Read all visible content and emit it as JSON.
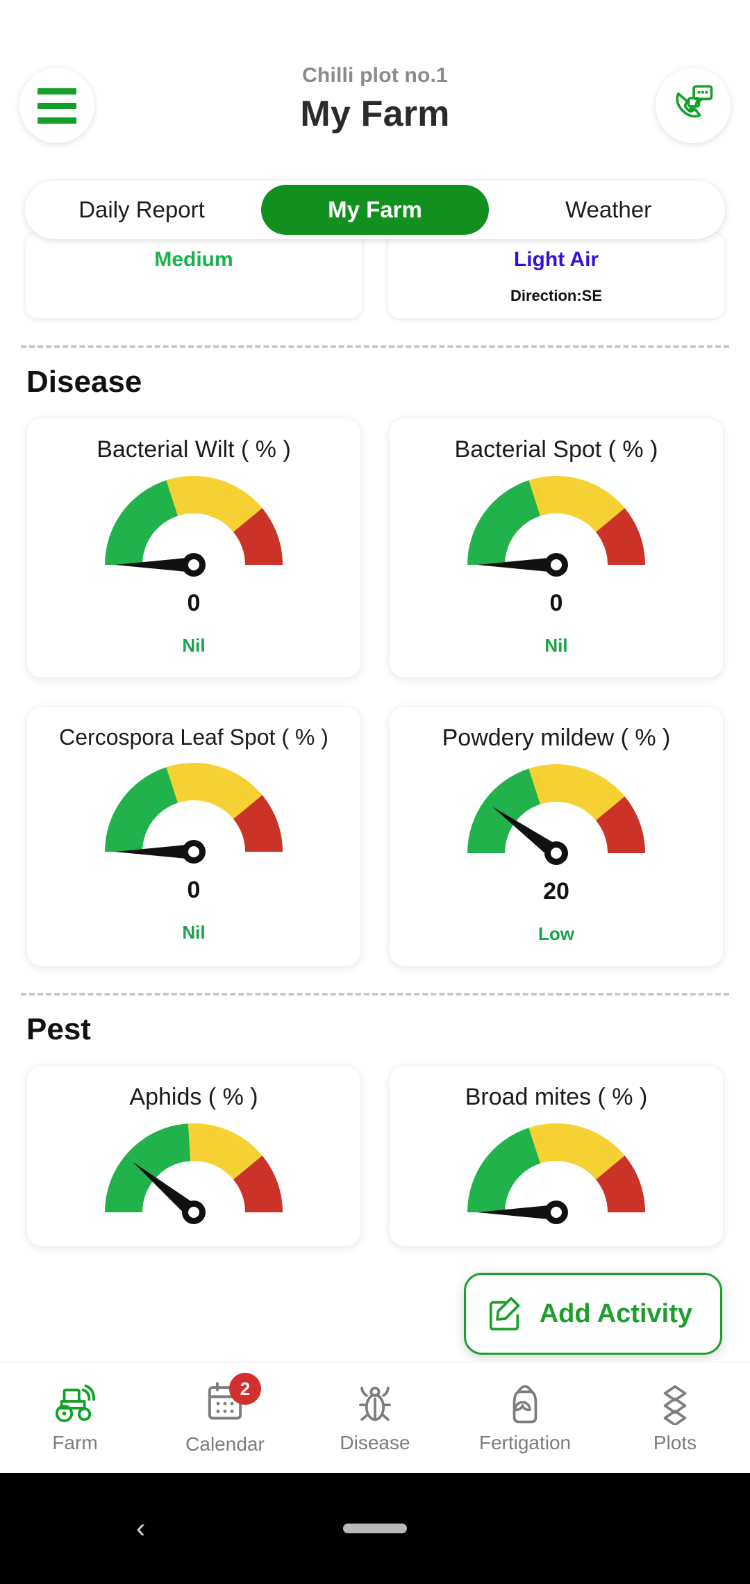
{
  "header": {
    "subtitle": "Chilli plot no.1",
    "title": "My Farm",
    "menu_icon": "hamburger-menu-icon",
    "support_icon": "phone-chat-support-icon"
  },
  "tabs": [
    {
      "label": "Daily Report",
      "active": false
    },
    {
      "label": "My Farm",
      "active": true
    },
    {
      "label": "Weather",
      "active": false
    }
  ],
  "weather_cards": [
    {
      "value": "Medium",
      "color": "#18B24C",
      "sub": ""
    },
    {
      "value": "Light Air",
      "color": "#3311DD",
      "sub": "Direction:SE"
    }
  ],
  "sections": {
    "disease": {
      "title": "Disease",
      "cards": [
        {
          "title": "Bacterial Wilt ( % )",
          "value": "0",
          "status": "Nil"
        },
        {
          "title": "Bacterial Spot ( % )",
          "value": "0",
          "status": "Nil"
        },
        {
          "title": "Cercospora Leaf Spot ( % )",
          "value": "0",
          "status": "Nil"
        },
        {
          "title": "Powdery mildew ( % )",
          "value": "20",
          "status": "Low"
        }
      ]
    },
    "pest": {
      "title": "Pest",
      "cards": [
        {
          "title": "Aphids ( % )",
          "value": "",
          "status": ""
        },
        {
          "title": "Broad mites ( % )",
          "value": "",
          "status": ""
        }
      ]
    }
  },
  "chart_data": [
    {
      "type": "gauge",
      "title": "Bacterial Wilt ( % )",
      "value": 0,
      "min": 0,
      "max": 100,
      "bands": [
        {
          "name": "green",
          "from": 0,
          "to": 40,
          "color": "#22B24C"
        },
        {
          "name": "yellow",
          "from": 40,
          "to": 78,
          "color": "#F5D133"
        },
        {
          "name": "red",
          "from": 78,
          "to": 100,
          "color": "#CC3328"
        }
      ],
      "status": "Nil",
      "needle_value": 0
    },
    {
      "type": "gauge",
      "title": "Bacterial Spot ( % )",
      "value": 0,
      "min": 0,
      "max": 100,
      "bands": [
        {
          "name": "green",
          "from": 0,
          "to": 40,
          "color": "#22B24C"
        },
        {
          "name": "yellow",
          "from": 40,
          "to": 78,
          "color": "#F5D133"
        },
        {
          "name": "red",
          "from": 78,
          "to": 100,
          "color": "#CC3328"
        }
      ],
      "status": "Nil",
      "needle_value": 0
    },
    {
      "type": "gauge",
      "title": "Cercospora Leaf Spot ( % )",
      "value": 0,
      "min": 0,
      "max": 100,
      "bands": [
        {
          "name": "green",
          "from": 0,
          "to": 40,
          "color": "#22B24C"
        },
        {
          "name": "yellow",
          "from": 40,
          "to": 78,
          "color": "#F5D133"
        },
        {
          "name": "red",
          "from": 78,
          "to": 100,
          "color": "#CC3328"
        }
      ],
      "status": "Nil",
      "needle_value": 0
    },
    {
      "type": "gauge",
      "title": "Powdery mildew ( % )",
      "value": 20,
      "min": 0,
      "max": 100,
      "bands": [
        {
          "name": "green",
          "from": 0,
          "to": 40,
          "color": "#22B24C"
        },
        {
          "name": "yellow",
          "from": 40,
          "to": 78,
          "color": "#F5D133"
        },
        {
          "name": "red",
          "from": 78,
          "to": 100,
          "color": "#CC3328"
        }
      ],
      "status": "Low",
      "needle_value": 20
    },
    {
      "type": "gauge",
      "title": "Aphids ( % )",
      "value": 22,
      "min": 0,
      "max": 100,
      "bands": [
        {
          "name": "green",
          "from": 0,
          "to": 48,
          "color": "#22B24C"
        },
        {
          "name": "yellow",
          "from": 48,
          "to": 78,
          "color": "#F5D133"
        },
        {
          "name": "red",
          "from": 78,
          "to": 100,
          "color": "#CC3328"
        }
      ],
      "status": "",
      "needle_value": 22
    },
    {
      "type": "gauge",
      "title": "Broad mites ( % )",
      "value": 0,
      "min": 0,
      "max": 100,
      "bands": [
        {
          "name": "green",
          "from": 0,
          "to": 40,
          "color": "#22B24C"
        },
        {
          "name": "yellow",
          "from": 40,
          "to": 78,
          "color": "#F5D133"
        },
        {
          "name": "red",
          "from": 78,
          "to": 100,
          "color": "#CC3328"
        }
      ],
      "status": "",
      "needle_value": 0
    }
  ],
  "fab": {
    "label": "Add Activity",
    "icon": "edit-pencil-icon",
    "color": "#1C9E2C"
  },
  "bottom_nav": [
    {
      "label": "Farm",
      "icon": "tractor-icon",
      "active": true,
      "badge": ""
    },
    {
      "label": "Calendar",
      "icon": "calendar-icon",
      "active": false,
      "badge": "2"
    },
    {
      "label": "Disease",
      "icon": "bug-icon",
      "active": false,
      "badge": ""
    },
    {
      "label": "Fertigation",
      "icon": "fertilizer-bag-icon",
      "active": false,
      "badge": ""
    },
    {
      "label": "Plots",
      "icon": "layers-icon",
      "active": false,
      "badge": ""
    }
  ],
  "system_nav": {
    "back_icon": "back-chevron-icon",
    "home_pill": "home-pill"
  },
  "colors": {
    "brand_green": "#12901F",
    "gauge_green": "#22B24C",
    "gauge_yellow": "#F5D133",
    "gauge_red": "#CC3328",
    "badge_red": "#D32F2F"
  }
}
